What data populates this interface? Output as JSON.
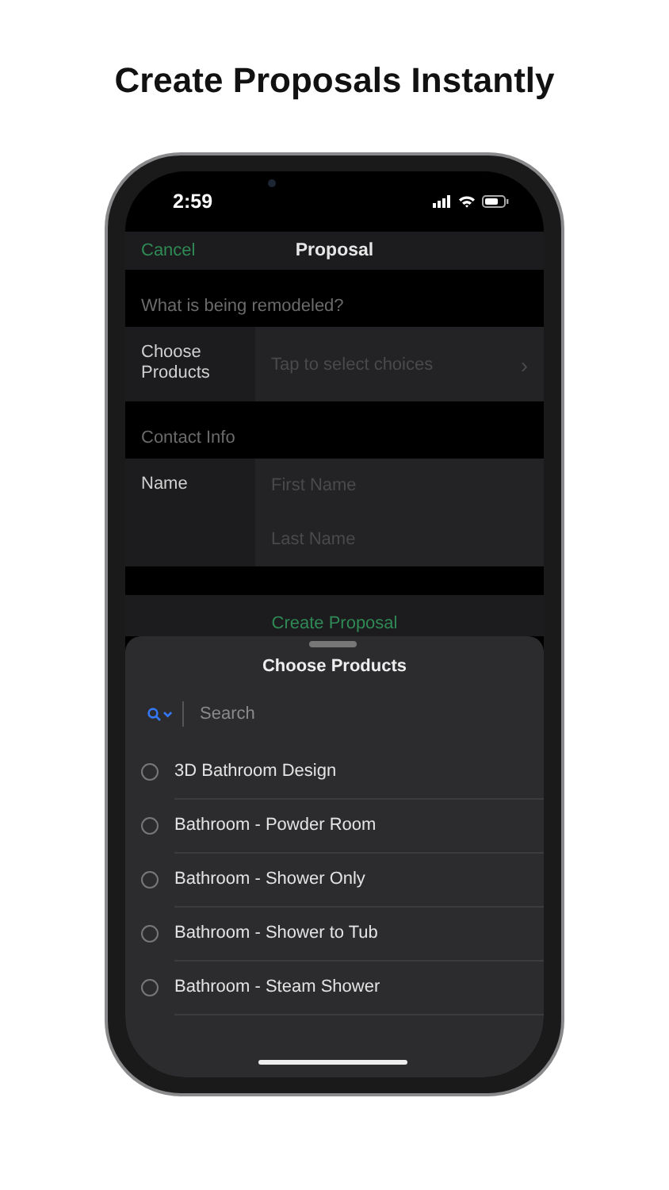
{
  "headline": "Create Proposals Instantly",
  "status_bar": {
    "time": "2:59"
  },
  "nav": {
    "cancel": "Cancel",
    "title": "Proposal"
  },
  "sections": [
    {
      "header": "What is being remodeled?",
      "rows": [
        {
          "kind": "chooser",
          "label": "Choose Products",
          "hint": "Tap to select choices",
          "chevron": "›"
        }
      ]
    },
    {
      "header": "Contact Info",
      "rows": [
        {
          "kind": "fields",
          "label": "Name",
          "fields": [
            {
              "placeholder": "First Name"
            },
            {
              "placeholder": "Last Name"
            }
          ]
        }
      ]
    }
  ],
  "action": "Create Proposal",
  "sheet": {
    "title": "Choose Products",
    "search": {
      "placeholder": "Search"
    },
    "items": [
      {
        "label": "3D Bathroom Design",
        "selected": false
      },
      {
        "label": "Bathroom - Powder Room",
        "selected": false
      },
      {
        "label": "Bathroom - Shower Only",
        "selected": false
      },
      {
        "label": "Bathroom - Shower to Tub",
        "selected": false
      },
      {
        "label": "Bathroom - Steam Shower",
        "selected": false
      }
    ]
  }
}
